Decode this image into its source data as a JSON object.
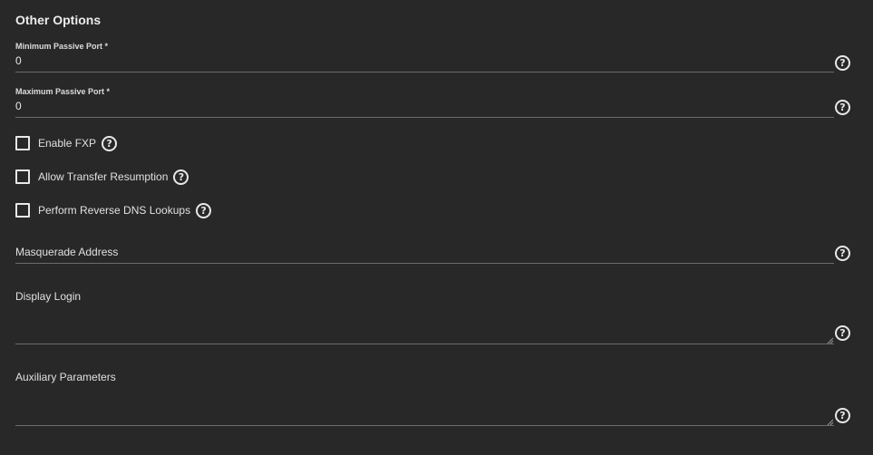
{
  "section": {
    "title": "Other Options"
  },
  "fields": {
    "min_passive_port": {
      "label": "Minimum Passive Port *",
      "value": "0"
    },
    "max_passive_port": {
      "label": "Maximum Passive Port *",
      "value": "0"
    },
    "masquerade_address": {
      "label": "Masquerade Address",
      "value": ""
    },
    "display_login": {
      "label": "Display Login",
      "value": ""
    },
    "auxiliary_parameters": {
      "label": "Auxiliary Parameters",
      "value": ""
    }
  },
  "checkboxes": {
    "enable_fxp": {
      "label": "Enable FXP",
      "checked": false
    },
    "allow_transfer_resumption": {
      "label": "Allow Transfer Resumption",
      "checked": false
    },
    "reverse_dns": {
      "label": "Perform Reverse DNS Lookups",
      "checked": false
    }
  },
  "icons": {
    "help": "?"
  },
  "colors": {
    "background": "#282828",
    "text": "#e6e6e6",
    "underline": "#6c6c6c"
  }
}
